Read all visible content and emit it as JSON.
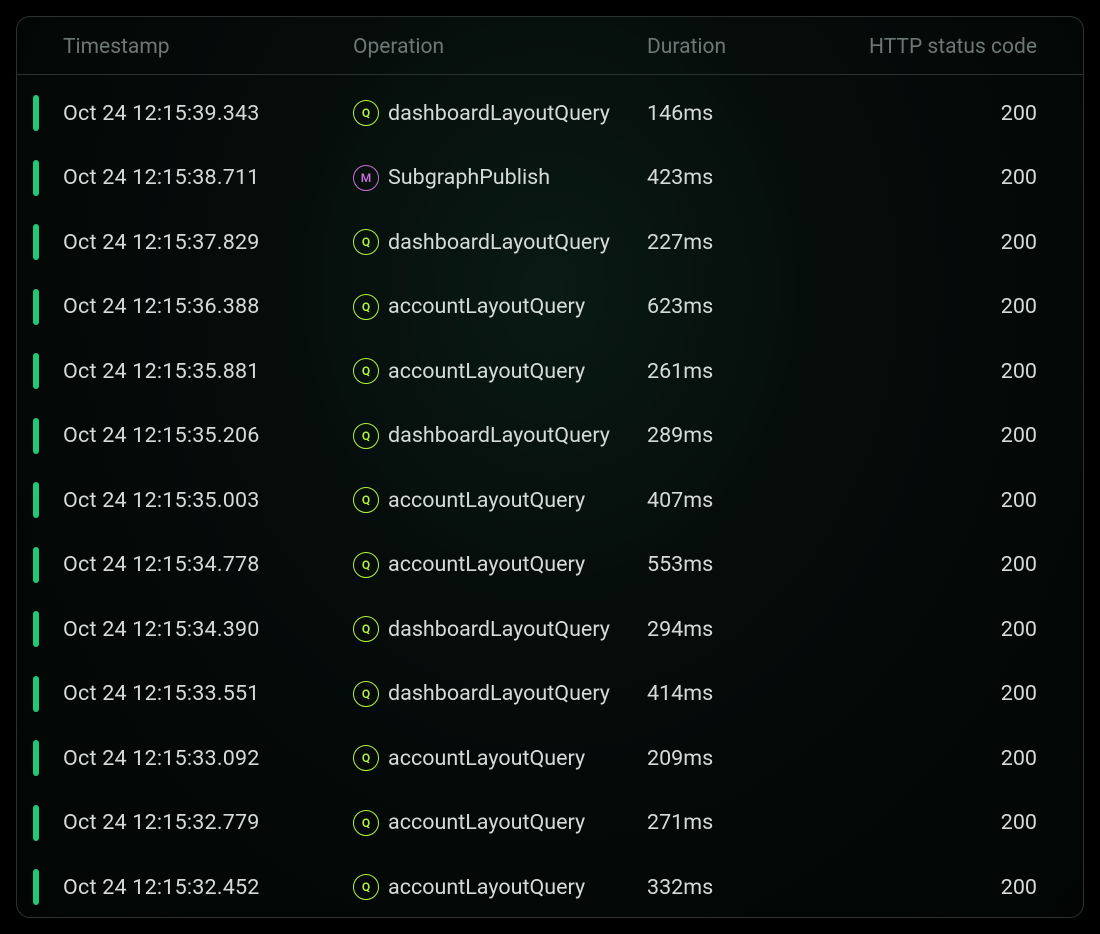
{
  "colors": {
    "query_badge": "#b6f23a",
    "mutation_badge": "#c86dd7",
    "status_ok": "#1fc977"
  },
  "headers": {
    "timestamp": "Timestamp",
    "operation": "Operation",
    "duration": "Duration",
    "status": "HTTP status code"
  },
  "rows": [
    {
      "timestamp": "Oct 24 12:15:39.343",
      "op_type": "Q",
      "operation": "dashboardLayoutQuery",
      "duration": "146ms",
      "status": "200"
    },
    {
      "timestamp": "Oct 24 12:15:38.711",
      "op_type": "M",
      "operation": "SubgraphPublish",
      "duration": "423ms",
      "status": "200"
    },
    {
      "timestamp": "Oct 24 12:15:37.829",
      "op_type": "Q",
      "operation": "dashboardLayoutQuery",
      "duration": "227ms",
      "status": "200"
    },
    {
      "timestamp": "Oct 24 12:15:36.388",
      "op_type": "Q",
      "operation": "accountLayoutQuery",
      "duration": "623ms",
      "status": "200"
    },
    {
      "timestamp": "Oct 24 12:15:35.881",
      "op_type": "Q",
      "operation": "accountLayoutQuery",
      "duration": "261ms",
      "status": "200"
    },
    {
      "timestamp": "Oct 24 12:15:35.206",
      "op_type": "Q",
      "operation": "dashboardLayoutQuery",
      "duration": "289ms",
      "status": "200"
    },
    {
      "timestamp": "Oct 24 12:15:35.003",
      "op_type": "Q",
      "operation": "accountLayoutQuery",
      "duration": "407ms",
      "status": "200"
    },
    {
      "timestamp": "Oct 24 12:15:34.778",
      "op_type": "Q",
      "operation": "accountLayoutQuery",
      "duration": "553ms",
      "status": "200"
    },
    {
      "timestamp": "Oct 24 12:15:34.390",
      "op_type": "Q",
      "operation": "dashboardLayoutQuery",
      "duration": "294ms",
      "status": "200"
    },
    {
      "timestamp": "Oct 24 12:15:33.551",
      "op_type": "Q",
      "operation": "dashboardLayoutQuery",
      "duration": "414ms",
      "status": "200"
    },
    {
      "timestamp": "Oct 24 12:15:33.092",
      "op_type": "Q",
      "operation": "accountLayoutQuery",
      "duration": "209ms",
      "status": "200"
    },
    {
      "timestamp": "Oct 24 12:15:32.779",
      "op_type": "Q",
      "operation": "accountLayoutQuery",
      "duration": "271ms",
      "status": "200"
    },
    {
      "timestamp": "Oct 24 12:15:32.452",
      "op_type": "Q",
      "operation": "accountLayoutQuery",
      "duration": "332ms",
      "status": "200"
    }
  ]
}
